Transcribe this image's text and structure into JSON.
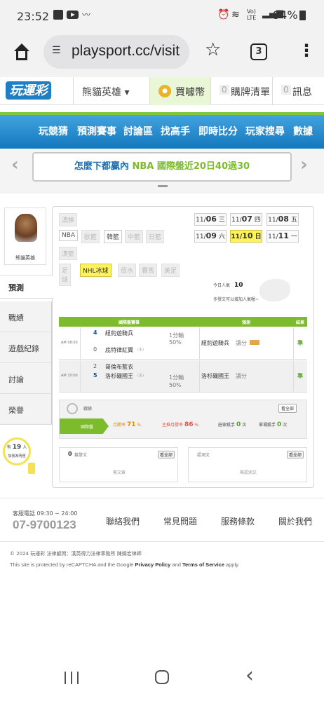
{
  "status": {
    "time": "23:52",
    "battery": "94%",
    "net": "Vo) LTE"
  },
  "browser": {
    "url": "playsport.cc/visit",
    "tab_count": "3"
  },
  "header": {
    "logo": "玩運彩",
    "user_menu": "熊貓英雄 ▾",
    "buy_coins": "買噱幣",
    "cart_count": "0",
    "cart_label": "購牌清單",
    "msg_count": "0",
    "msg_label": "訊息"
  },
  "nav": {
    "items": [
      "玩競猜",
      "預測賽事",
      "討論區",
      "找高手",
      "即時比分",
      "玩家搜尋",
      "數據"
    ]
  },
  "banner": {
    "text_prefix": "怎麼下都贏內 ",
    "text_highlight": "NBA 國際盤近20日40過30"
  },
  "profile": {
    "name": "熊貓英雄"
  },
  "sidebar": {
    "items": [
      "預測",
      "戰績",
      "遊戲紀錄",
      "討論",
      "榮譽"
    ],
    "likes_prefix": "有",
    "likes_count": "19",
    "likes_suffix": "人",
    "likes_sub": "加我為明燈"
  },
  "leagues": {
    "row1": [
      "澳棒"
    ],
    "row2": [
      "NBA",
      "歐籃",
      "韓籃",
      "中籃",
      "日籃"
    ],
    "row3": [
      "澳籃"
    ],
    "row4": [
      "足球",
      "NHL冰球",
      "佰水",
      "賽馬",
      "美足"
    ]
  },
  "dates": {
    "row1": [
      {
        "md": "11/",
        "d": "06",
        "w": "三"
      },
      {
        "md": "11/",
        "d": "07",
        "w": "四"
      },
      {
        "md": "11/",
        "d": "08",
        "w": "五"
      }
    ],
    "row2": [
      {
        "md": "11/",
        "d": "09",
        "w": "六"
      },
      {
        "md": "11/",
        "d": "10",
        "w": "日"
      },
      {
        "md": "11/",
        "d": "11",
        "w": "一"
      }
    ]
  },
  "popularity": {
    "label": "今日人氣",
    "value": "10",
    "note": "多發文可以增加人氣喔~"
  },
  "table": {
    "headers": [
      "國際盤賽事",
      "預測",
      "結果"
    ],
    "rows": [
      {
        "time": "AM 08:00",
        "n1": "4",
        "team1": "紐約遊騎兵",
        "n2": "0",
        "team2": "底特律紅翼",
        "mark2": "(主)",
        "line": "1分輸",
        "pct": "50%",
        "pick": "紐約遊騎兵",
        "pick_type": "讓分",
        "result": "準"
      },
      {
        "time": "AM 10:00",
        "n1": "2",
        "team1": "哥倫布藍衣",
        "n2": "5",
        "team2": "洛杉磯國王",
        "mark2": "(主)",
        "line": "1分輸",
        "pct": "50%",
        "pick": "洛杉磯國王",
        "pick_type": "讓分",
        "result": "準"
      }
    ]
  },
  "record": {
    "label": "戰績",
    "see_all": "看全部",
    "cells": [
      {
        "label": "國際盤"
      },
      {
        "label": "月勝率",
        "value": "71",
        "unit": "%"
      },
      {
        "label": "主推月勝率",
        "value": "86",
        "unit": "%"
      },
      {
        "label": "莊家殺手",
        "value": "0",
        "unit": "次"
      },
      {
        "label": "單場殺手",
        "value": "0",
        "unit": "次"
      }
    ]
  },
  "posts": {
    "left_count": "0",
    "left_label": "篇發文",
    "left_see": "看全部",
    "left_empty": "無文章",
    "right_label": "認測文",
    "right_see": "看全部",
    "right_empty": "無認測文"
  },
  "footer": {
    "hours": "客服電話 09:30 ~ 24:00",
    "phone": "07-9700123",
    "links": [
      "聯絡我們",
      "常見問題",
      "服務條款",
      "關於我們"
    ],
    "copyright": "© 2024 玩運彩 法律顧問：漢英得力法律事務所 陳錦宏律師",
    "recaptcha_prefix": "This site is protected by reCAPTCHA and the Google ",
    "privacy": "Privacy Policy",
    "and": " and ",
    "terms": "Terms of Service",
    "apply": " apply."
  },
  "colors": {
    "green": "#7cbb2b",
    "nav_blue": "#1d86c8",
    "accent_yellow": "#fff35c",
    "result_green": "#55a022"
  }
}
